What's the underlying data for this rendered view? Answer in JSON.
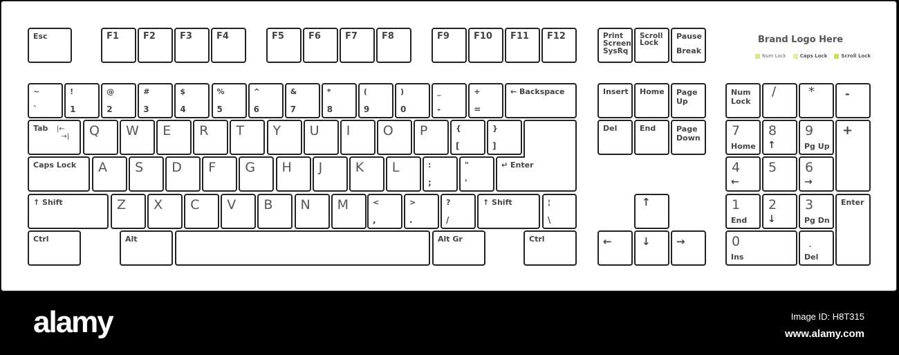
{
  "brand": {
    "title": "Brand Logo Here",
    "leds": [
      {
        "label": "Num Lock",
        "color": "#d7e98a"
      },
      {
        "label": "Caps Lock",
        "color": "#e4ef9e"
      },
      {
        "label": "Scroll Lock",
        "color": "#c9df5a"
      }
    ]
  },
  "keys": {
    "esc": "Esc",
    "f1": "F1",
    "f2": "F2",
    "f3": "F3",
    "f4": "F4",
    "f5": "F5",
    "f6": "F6",
    "f7": "F7",
    "f8": "F8",
    "f9": "F9",
    "f10": "F10",
    "f11": "F11",
    "f12": "F12",
    "print_screen": "Print\nScreen\nSysRq",
    "scroll_lock": "Scroll\nLock",
    "pause_top": "Pause",
    "pause_bottom": "Break",
    "number_row": [
      {
        "top": "~",
        "bottom": "`"
      },
      {
        "top": "!",
        "bottom": "1"
      },
      {
        "top": "@",
        "bottom": "2"
      },
      {
        "top": "#",
        "bottom": "3"
      },
      {
        "top": "$",
        "bottom": "4"
      },
      {
        "top": "%",
        "bottom": "5"
      },
      {
        "top": "^",
        "bottom": "6"
      },
      {
        "top": "&",
        "bottom": "7"
      },
      {
        "top": "*",
        "bottom": "8"
      },
      {
        "top": "(",
        "bottom": "9"
      },
      {
        "top": ")",
        "bottom": "0"
      },
      {
        "top": "_",
        "bottom": "-"
      },
      {
        "top": "+",
        "bottom": "="
      }
    ],
    "backspace": "← Backspace",
    "tab": "Tab",
    "tab_arrows": "|←\n  →|",
    "qwerty": [
      "Q",
      "W",
      "E",
      "R",
      "T",
      "Y",
      "U",
      "I",
      "O",
      "P"
    ],
    "brace_open": {
      "top": "{",
      "bottom": "["
    },
    "brace_close": {
      "top": "}",
      "bottom": "]"
    },
    "caps_lock": "Caps Lock",
    "asdf": [
      "A",
      "S",
      "D",
      "F",
      "G",
      "H",
      "J",
      "K",
      "L"
    ],
    "semicolon": {
      "top": ":",
      "bottom": ";"
    },
    "quote": {
      "top": "\"",
      "bottom": "'"
    },
    "enter": "↵ Enter",
    "shift_left": "↑ Shift",
    "zxcv": [
      "Z",
      "X",
      "C",
      "V",
      "B",
      "N",
      "M"
    ],
    "comma": {
      "top": "<",
      "bottom": ","
    },
    "period": {
      "top": ">",
      "bottom": "."
    },
    "slash": {
      "top": "?",
      "bottom": "/"
    },
    "shift_right": "↑ Shift",
    "backslash": {
      "top": "¦",
      "bottom": "\\"
    },
    "ctrl_left": "Ctrl",
    "alt": "Alt",
    "alt_gr": "Alt Gr",
    "ctrl_right": "Ctrl",
    "insert": "Insert",
    "home": "Home",
    "page_up": "Page\nUp",
    "delete": "Del",
    "end": "End",
    "page_down": "Page\nDown",
    "arrow_up": "↑",
    "arrow_left": "←",
    "arrow_down": "↓",
    "arrow_right": "→",
    "num_lock": "Num\nLock",
    "num_divide": "/",
    "num_multiply": "*",
    "num_minus": "-",
    "num_plus": "+",
    "num_enter": "Enter",
    "num7": {
      "big": "7",
      "small": "Home"
    },
    "num8": {
      "big": "8",
      "small": "↑"
    },
    "num9": {
      "big": "9",
      "small": "Pg Up"
    },
    "num4": {
      "big": "4",
      "small": "←"
    },
    "num5": {
      "big": "5",
      "small": ""
    },
    "num6": {
      "big": "6",
      "small": "→"
    },
    "num1": {
      "big": "1",
      "small": "End"
    },
    "num2": {
      "big": "2",
      "small": "↓"
    },
    "num3": {
      "big": "3",
      "small": "Pg Dn"
    },
    "num0": {
      "big": "0",
      "small": "Ins"
    },
    "num_dot": {
      "big": ".",
      "small": "Del"
    }
  },
  "footer": {
    "logo": "alamy",
    "image_id": "Image ID: H8T315",
    "site": "www.alamy.com"
  }
}
